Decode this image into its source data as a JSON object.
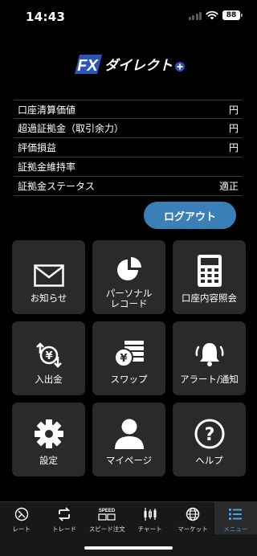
{
  "status": {
    "time": "14:43",
    "battery": "88"
  },
  "logo": {
    "brand": "FX",
    "name": "ダイレクト",
    "plus": "+"
  },
  "account_info": [
    {
      "label": "口座清算価値",
      "value": "円"
    },
    {
      "label": "超過証拠金（取引余力）",
      "value": "円"
    },
    {
      "label": "評価損益",
      "value": "円"
    },
    {
      "label": "証拠金維持率",
      "value": ""
    },
    {
      "label": "証拠金ステータス",
      "value": "適正"
    }
  ],
  "logout_label": "ログアウト",
  "menu": [
    {
      "label": "お知らせ",
      "icon": "envelope-icon"
    },
    {
      "label": "パーソナル\nレコード",
      "icon": "pie-chart-icon"
    },
    {
      "label": "口座内容照会",
      "icon": "calculator-icon"
    },
    {
      "label": "入出金",
      "icon": "yen-transfer-icon"
    },
    {
      "label": "スワップ",
      "icon": "yen-coins-icon"
    },
    {
      "label": "アラート/通知",
      "icon": "bell-icon"
    },
    {
      "label": "設定",
      "icon": "gear-icon"
    },
    {
      "label": "マイページ",
      "icon": "person-icon"
    },
    {
      "label": "ヘルプ",
      "icon": "help-icon"
    }
  ],
  "tabs": [
    {
      "label": "レート",
      "icon": "rate-icon",
      "active": false
    },
    {
      "label": "トレード",
      "icon": "trade-icon",
      "active": false
    },
    {
      "label": "スピード注文",
      "icon": "speed-order-icon",
      "active": false
    },
    {
      "label": "チャート",
      "icon": "chart-icon",
      "active": false
    },
    {
      "label": "マーケット",
      "icon": "globe-icon",
      "active": false
    },
    {
      "label": "メニュー",
      "icon": "menu-icon",
      "active": true
    }
  ],
  "colors": {
    "accent": "#3a80b8",
    "tile": "#2a2a2a",
    "active_tab_text": "#4aa3e0"
  }
}
